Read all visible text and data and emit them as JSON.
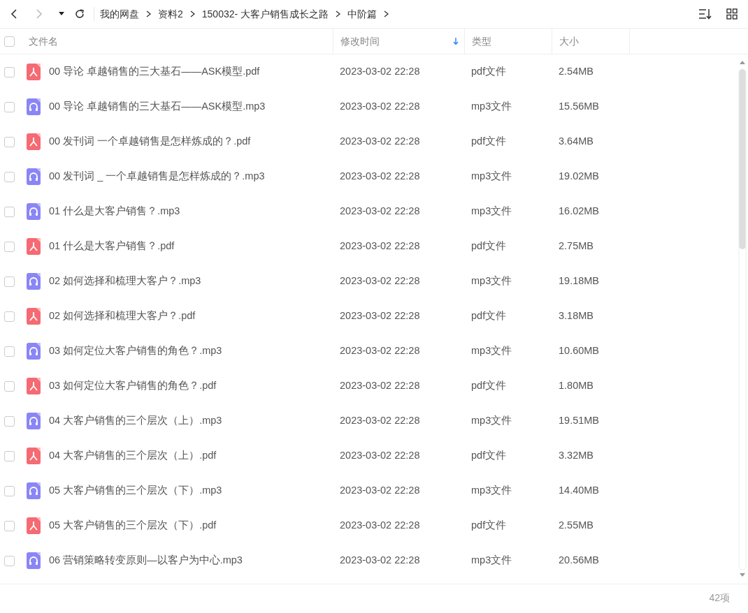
{
  "toolbar": {
    "back": {
      "disabled": false
    },
    "forward": {
      "disabled": true
    },
    "breadcrumbs": [
      "我的网盘",
      "资料2",
      "150032- 大客户销售成长之路",
      "中阶篇"
    ]
  },
  "table": {
    "select_all": {
      "checked": false
    },
    "columns": [
      {
        "label": "文件名",
        "sorted": false
      },
      {
        "label": "修改时间",
        "sorted": true
      },
      {
        "label": "类型",
        "sorted": false
      },
      {
        "label": "大小",
        "sorted": false
      }
    ],
    "rows": [
      {
        "kind": "pdf",
        "checked": false,
        "name": "00 导论  卓越销售的三大基石——ASK模型.pdf",
        "modified": "2023-03-02 22:28",
        "type": "pdf文件",
        "size": "2.54MB"
      },
      {
        "kind": "mp3",
        "checked": false,
        "name": "00 导论 卓越销售的三大基石——ASK模型.mp3",
        "modified": "2023-03-02 22:28",
        "type": "mp3文件",
        "size": "15.56MB"
      },
      {
        "kind": "pdf",
        "checked": false,
        "name": "00 发刊词  一个卓越销售是怎样炼成的？.pdf",
        "modified": "2023-03-02 22:28",
        "type": "pdf文件",
        "size": "3.64MB"
      },
      {
        "kind": "mp3",
        "checked": false,
        "name": "00 发刊词 _ 一个卓越销售是怎样炼成的？.mp3",
        "modified": "2023-03-02 22:28",
        "type": "mp3文件",
        "size": "19.02MB"
      },
      {
        "kind": "mp3",
        "checked": false,
        "name": "01 什么是大客户销售？.mp3",
        "modified": "2023-03-02 22:28",
        "type": "mp3文件",
        "size": "16.02MB"
      },
      {
        "kind": "pdf",
        "checked": false,
        "name": "01 什么是大客户销售？.pdf",
        "modified": "2023-03-02 22:28",
        "type": "pdf文件",
        "size": "2.75MB"
      },
      {
        "kind": "mp3",
        "checked": false,
        "name": "02 如何选择和梳理大客户？.mp3",
        "modified": "2023-03-02 22:28",
        "type": "mp3文件",
        "size": "19.18MB"
      },
      {
        "kind": "pdf",
        "checked": false,
        "name": "02 如何选择和梳理大客户？.pdf",
        "modified": "2023-03-02 22:28",
        "type": "pdf文件",
        "size": "3.18MB"
      },
      {
        "kind": "mp3",
        "checked": false,
        "name": "03 如何定位大客户销售的角色？.mp3",
        "modified": "2023-03-02 22:28",
        "type": "mp3文件",
        "size": "10.60MB"
      },
      {
        "kind": "pdf",
        "checked": false,
        "name": "03 如何定位大客户销售的角色？.pdf",
        "modified": "2023-03-02 22:28",
        "type": "pdf文件",
        "size": "1.80MB"
      },
      {
        "kind": "mp3",
        "checked": false,
        "name": "04 大客户销售的三个层次（上）.mp3",
        "modified": "2023-03-02 22:28",
        "type": "mp3文件",
        "size": "19.51MB"
      },
      {
        "kind": "pdf",
        "checked": false,
        "name": "04 大客户销售的三个层次（上）.pdf",
        "modified": "2023-03-02 22:28",
        "type": "pdf文件",
        "size": "3.32MB"
      },
      {
        "kind": "mp3",
        "checked": false,
        "name": "05 大客户销售的三个层次（下）.mp3",
        "modified": "2023-03-02 22:28",
        "type": "mp3文件",
        "size": "14.40MB"
      },
      {
        "kind": "pdf",
        "checked": false,
        "name": "05 大客户销售的三个层次（下）.pdf",
        "modified": "2023-03-02 22:28",
        "type": "pdf文件",
        "size": "2.55MB"
      },
      {
        "kind": "mp3",
        "checked": false,
        "name": "06 营销策略转变原则—以客户为中心.mp3",
        "modified": "2023-03-02 22:28",
        "type": "mp3文件",
        "size": "20.56MB"
      }
    ]
  },
  "status_bar": {
    "count": "42项"
  }
}
